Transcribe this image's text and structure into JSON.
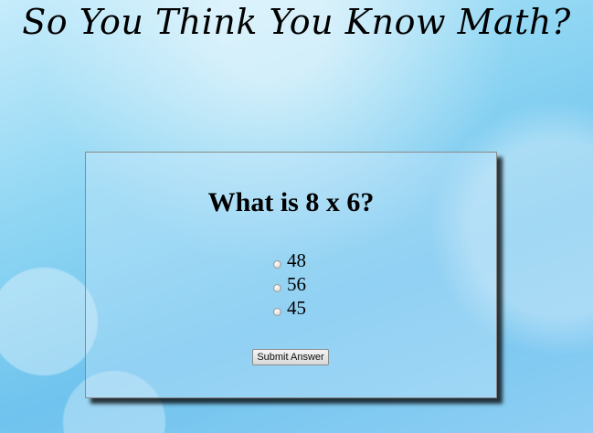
{
  "page": {
    "title": "So You Think You Know Math?"
  },
  "quiz": {
    "question": "What is 8 x 6?",
    "options": [
      {
        "label": "48",
        "selected": false
      },
      {
        "label": "56",
        "selected": false
      },
      {
        "label": "45",
        "selected": false
      }
    ],
    "submit_label": "Submit Answer"
  }
}
